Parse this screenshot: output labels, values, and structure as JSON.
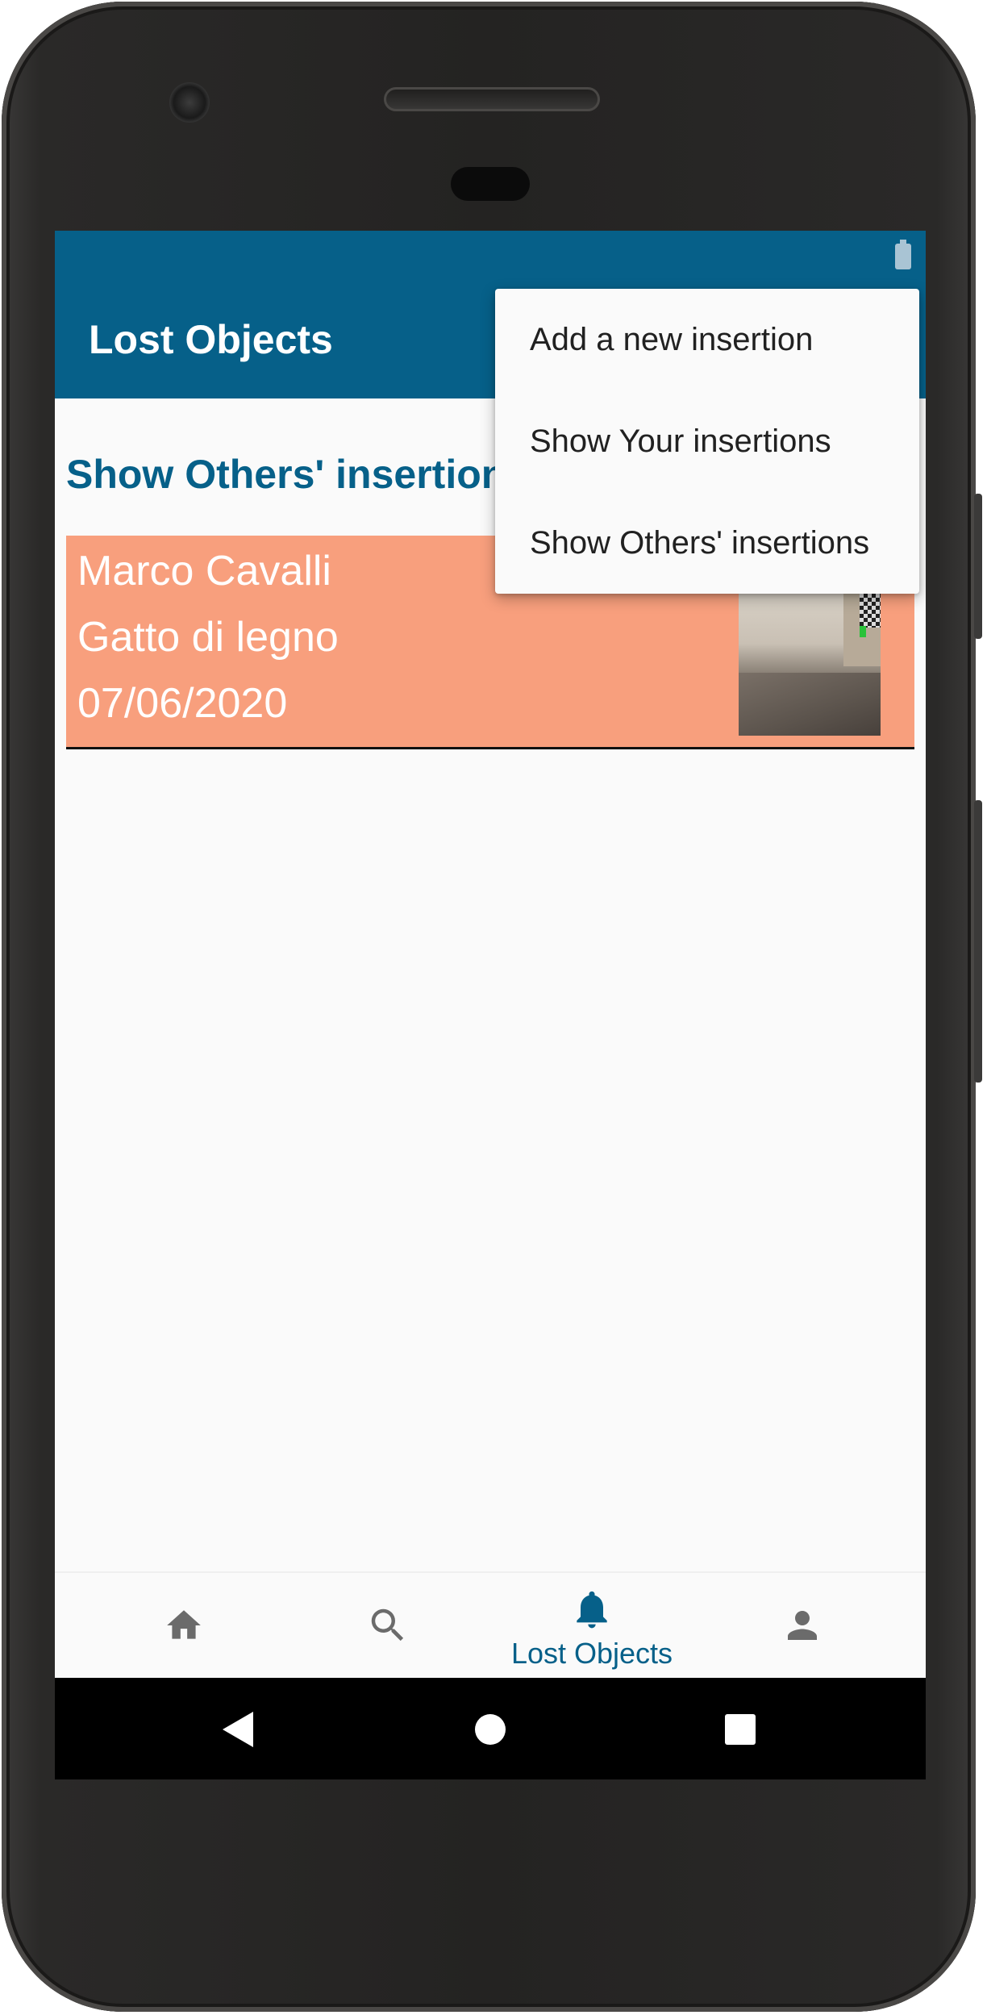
{
  "app": {
    "title": "Lost Objects",
    "section_title": "Show Others' insertions"
  },
  "colors": {
    "primary": "#066089",
    "card_background": "#f89f7d",
    "screen_background": "#fafafa"
  },
  "menu": {
    "items": [
      {
        "label": "Add a new insertion"
      },
      {
        "label": "Show Your insertions"
      },
      {
        "label": "Show Others' insertions"
      }
    ]
  },
  "insertions": [
    {
      "name": "Marco Cavalli",
      "object": "Gatto di legno",
      "date": "07/06/2020"
    }
  ],
  "bottom_nav": {
    "items": [
      {
        "icon": "home-icon",
        "label": ""
      },
      {
        "icon": "search-icon",
        "label": ""
      },
      {
        "icon": "bell-icon",
        "label": "Lost Objects",
        "active": true
      },
      {
        "icon": "person-icon",
        "label": ""
      }
    ]
  },
  "system_nav": {
    "icons": [
      "back-icon",
      "home-circle-icon",
      "recents-icon"
    ]
  }
}
